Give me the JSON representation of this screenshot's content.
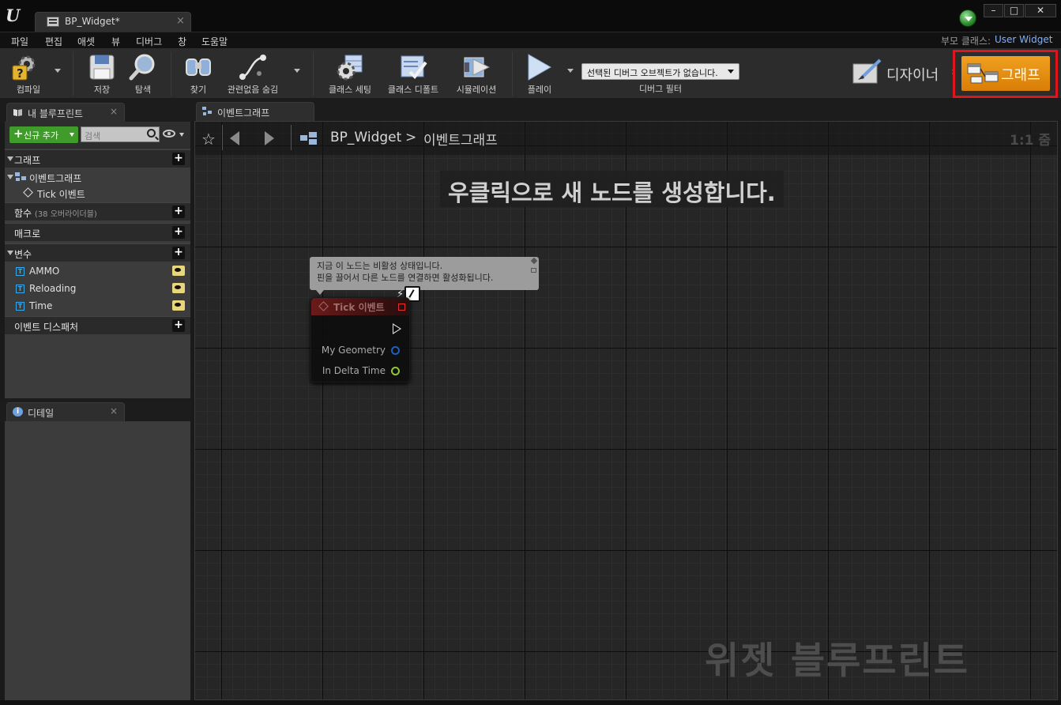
{
  "window": {
    "logo": "U",
    "document_tab": "BP_Widget*",
    "tab_close": "×",
    "controls": [
      "–",
      "□",
      "✕"
    ]
  },
  "menu": {
    "items": [
      "파일",
      "편집",
      "애셋",
      "뷰",
      "디버그",
      "창",
      "도움말"
    ],
    "parent_class_label": "부모 클래스:",
    "parent_class_value": "User Widget"
  },
  "toolbar": {
    "compile": "컴파일",
    "save": "저장",
    "browse": "탐색",
    "find": "찾기",
    "hide_unrelated": "관련없음 숨김",
    "class_settings": "클래스 세팅",
    "class_defaults": "클래스 디폴트",
    "simulation": "시뮬레이션",
    "play": "플레이",
    "debug_filter_value": "선택된 디버그 오브젝트가 없습니다.",
    "debug_filter_label": "디버그 필터",
    "designer_mode": "디자이너",
    "mode_chevron": "›",
    "graph_mode": "그래프"
  },
  "my_blueprint": {
    "tab_label": "내 블루프린트",
    "tab_close": "×",
    "add_new": "신규 추가",
    "search_placeholder": "검색",
    "sections": {
      "graphs": "그래프",
      "event_graph": "이벤트그래프",
      "tick_event": "Tick 이벤트",
      "functions": "함수",
      "functions_sub": "(38 오버라이더블)",
      "macros": "매크로",
      "variables": "변수",
      "event_dispatchers": "이벤트 디스패처"
    },
    "variables": [
      {
        "name": "AMMO",
        "type_glyph": "T"
      },
      {
        "name": "Reloading",
        "type_glyph": "T"
      },
      {
        "name": "Time",
        "type_glyph": "T"
      }
    ],
    "plus": "+"
  },
  "details": {
    "tab_label": "디테일",
    "tab_close": "×",
    "icon": "i"
  },
  "graph_editor": {
    "tab_label": "이벤트그래프",
    "breadcrumb_blueprint": "BP_Widget",
    "breadcrumb_separator": ">",
    "breadcrumb_graph": "이벤트그래프",
    "bookmark_icon": "☆",
    "zoom": "1:1 줌",
    "hint": "우클릭으로 새 노드를 생성합니다.",
    "watermark": "위젯 블루프린트"
  },
  "tick_node": {
    "title": "Tick 이벤트",
    "comment_line1": "지금 이 노드는 비활성 상태입니다.",
    "comment_line2": "핀을 끌어서 다른 노드를 연결하면 활성화됩니다.",
    "pins": [
      {
        "name": "My Geometry",
        "color": "#1f5fb8"
      },
      {
        "name": "In Delta Time",
        "color": "#8fc63a"
      }
    ]
  },
  "colors": {
    "graph_mode_active": "#e88d12",
    "highlight_box": "#e0141d",
    "add_new_button": "#3f9c2b",
    "link_text": "#7fb0ff"
  }
}
